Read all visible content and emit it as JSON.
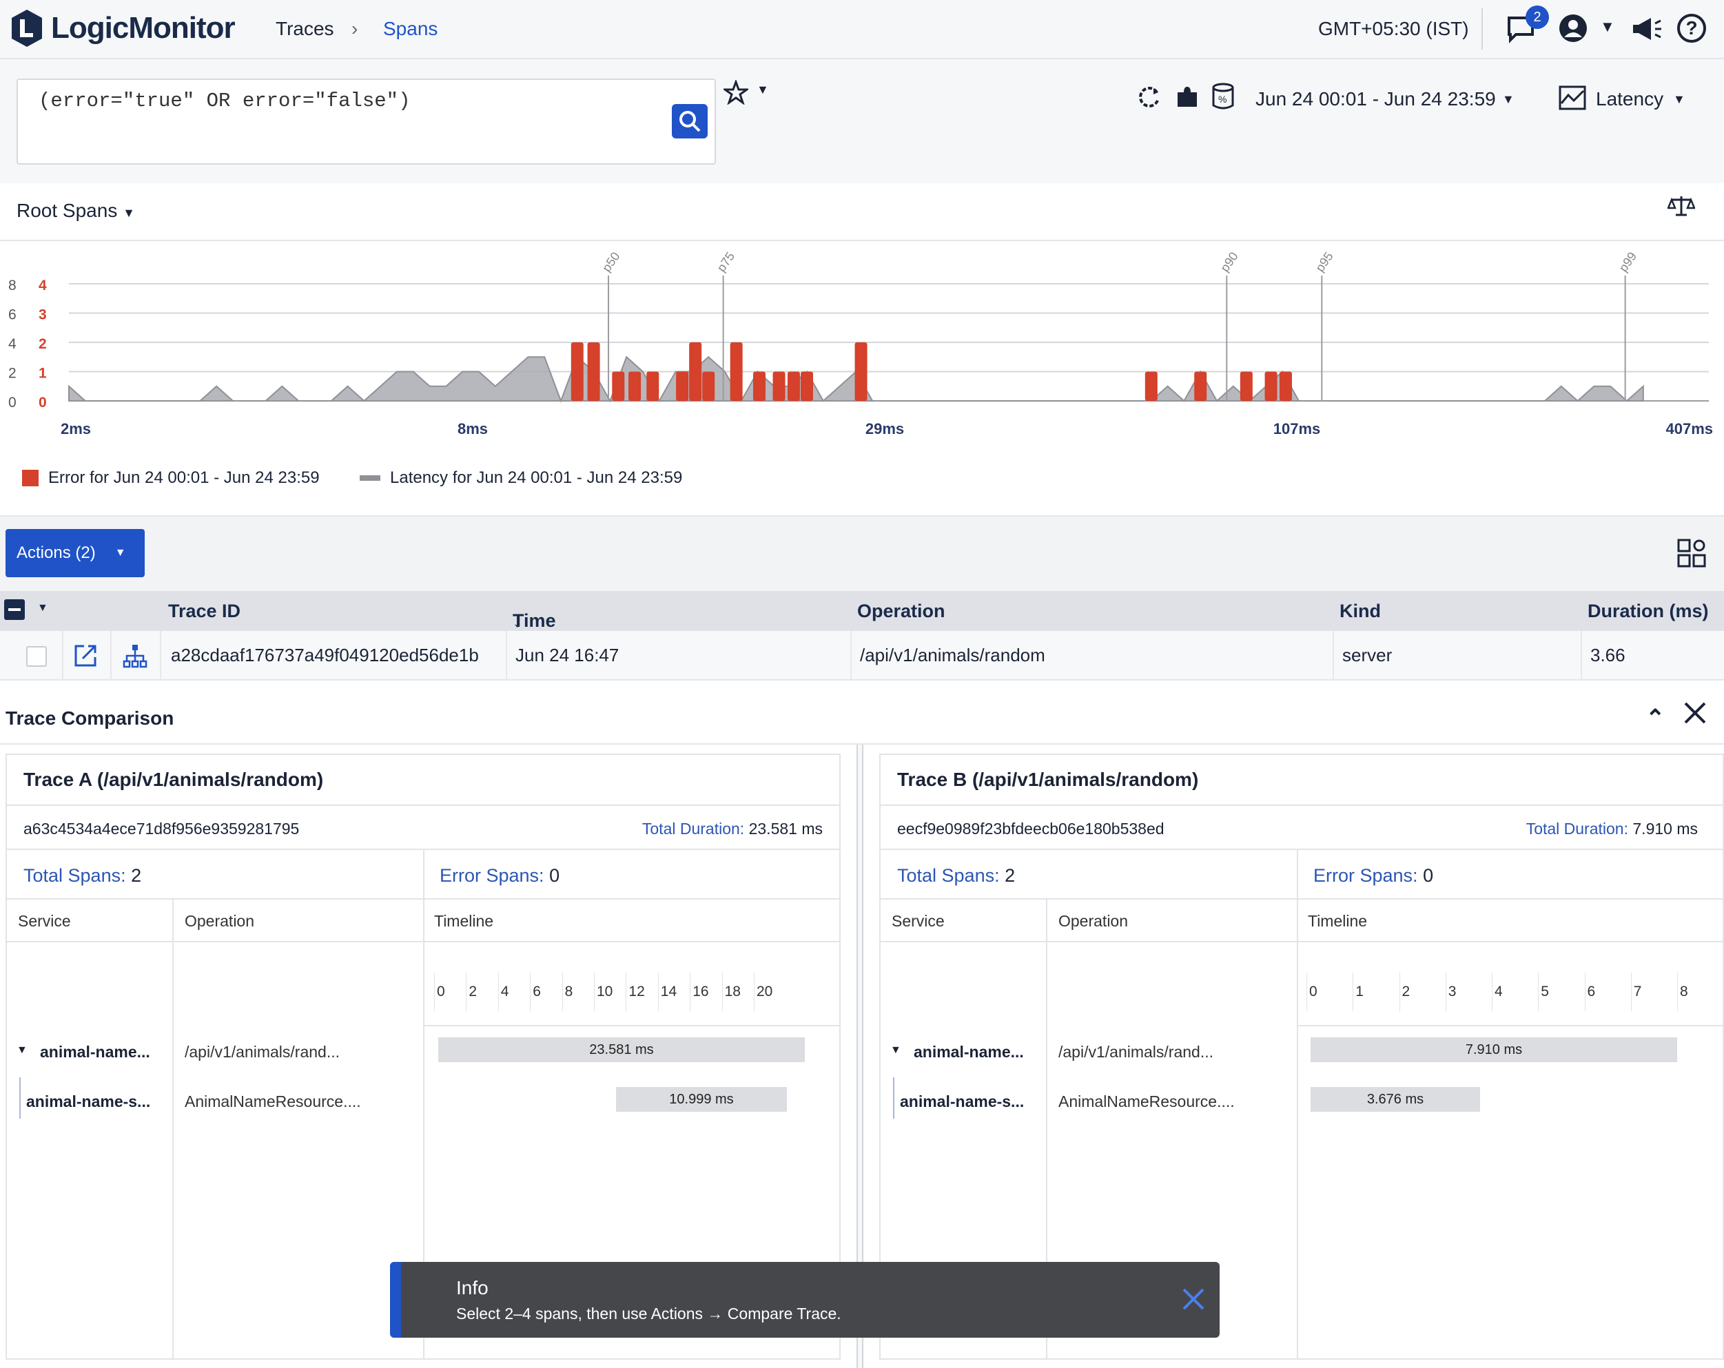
{
  "app": {
    "logo_text": "LogicMonitor"
  },
  "breadcrumb": {
    "parent": "Traces",
    "current": "Spans"
  },
  "header": {
    "timezone": "GMT+05:30 (IST)",
    "notification_count": "2"
  },
  "query": {
    "text": "(error=\"true\" OR error=\"false\")"
  },
  "toolbar": {
    "time_range": "Jun 24 00:01 - Jun 24 23:59",
    "metric": "Latency"
  },
  "chart_section": {
    "title": "Root Spans"
  },
  "chart_data": {
    "type": "bar",
    "left_axis_ticks": [
      "8",
      "6",
      "4",
      "2",
      "0"
    ],
    "right_axis_ticks": [
      "4",
      "3",
      "2",
      "1",
      "0"
    ],
    "x_tick_labels": [
      "2ms",
      "8ms",
      "29ms",
      "107ms",
      "407ms"
    ],
    "percentile_markers": [
      "p50",
      "p75",
      "p90",
      "p95",
      "p99"
    ],
    "percentile_positions": [
      32.9,
      39.9,
      70.6,
      76.4,
      94.9
    ],
    "error_bars_x": [
      31,
      32,
      33.5,
      34.5,
      35.6,
      37.4,
      38.2,
      39,
      40.7,
      42.1,
      43.3,
      44.2,
      45,
      48.3,
      66,
      69,
      71.8,
      73.3,
      74.2
    ],
    "error_bars_count": [
      2,
      2,
      1,
      1,
      1,
      1,
      2,
      1,
      2,
      1,
      1,
      1,
      1,
      2,
      1,
      1,
      1,
      1,
      1
    ],
    "latency_area": [
      [
        0,
        0.5
      ],
      [
        1,
        0
      ],
      [
        8,
        0
      ],
      [
        9,
        0.5
      ],
      [
        10,
        0
      ],
      [
        12,
        0
      ],
      [
        13,
        0.5
      ],
      [
        14,
        0
      ],
      [
        16,
        0
      ],
      [
        17,
        0.5
      ],
      [
        18,
        0
      ],
      [
        19,
        0.5
      ],
      [
        20,
        1
      ],
      [
        21,
        1
      ],
      [
        22,
        0.5
      ],
      [
        23,
        0.5
      ],
      [
        24,
        1
      ],
      [
        25,
        1
      ],
      [
        26,
        0.5
      ],
      [
        27,
        1
      ],
      [
        28,
        1.5
      ],
      [
        29,
        1.5
      ],
      [
        30,
        0
      ],
      [
        31,
        1.5
      ],
      [
        32,
        1
      ],
      [
        33,
        0
      ],
      [
        34,
        1.5
      ],
      [
        35,
        1
      ],
      [
        36,
        0
      ],
      [
        37,
        1
      ],
      [
        38,
        1
      ],
      [
        39,
        1.5
      ],
      [
        40,
        1
      ],
      [
        41,
        0
      ],
      [
        42,
        1
      ],
      [
        43,
        0.5
      ],
      [
        44,
        0.5
      ],
      [
        45,
        1
      ],
      [
        46,
        0
      ],
      [
        47,
        0.5
      ],
      [
        48,
        1
      ],
      [
        49,
        0
      ],
      [
        66,
        0
      ],
      [
        67,
        0.5
      ],
      [
        68,
        0
      ],
      [
        69,
        1
      ],
      [
        70,
        0
      ],
      [
        71,
        0.5
      ],
      [
        72,
        0
      ],
      [
        73,
        0.5
      ],
      [
        74,
        1
      ],
      [
        75,
        0
      ],
      [
        90,
        0
      ],
      [
        91,
        0.5
      ],
      [
        92,
        0
      ],
      [
        93,
        0.5
      ],
      [
        94,
        0.5
      ],
      [
        95,
        0
      ],
      [
        96,
        0.5
      ]
    ],
    "legend": [
      "Error for Jun 24 00:01 - Jun 24 23:59",
      "Latency for Jun 24 00:01 - Jun 24 23:59"
    ],
    "colors": {
      "error": "#d5412a",
      "latency": "#a9abb1"
    }
  },
  "actions": {
    "label": "Actions (2)"
  },
  "table": {
    "columns": [
      "Trace ID",
      "Time",
      "Operation",
      "Kind",
      "Duration (ms)"
    ],
    "rows": [
      {
        "trace_id": "a28cdaaf176737a49f049120ed56de1b",
        "time": "Jun 24 16:47",
        "operation": "/api/v1/animals/random",
        "kind": "server",
        "duration": "3.66"
      }
    ]
  },
  "comparison": {
    "title": "Trace Comparison",
    "col_service": "Service",
    "col_operation": "Operation",
    "col_timeline": "Timeline",
    "total_spans_label": "Total Spans:",
    "error_spans_label": "Error Spans:",
    "total_duration_label": "Total Duration:",
    "trace_a": {
      "title": "Trace A (/api/v1/animals/random)",
      "id": "a63c4534a4ece71d8f956e9359281795",
      "total_duration": "23.581 ms",
      "total_spans": "2",
      "error_spans": "0",
      "ticks": [
        "0",
        "2",
        "4",
        "6",
        "8",
        "10",
        "12",
        "14",
        "16",
        "18",
        "20"
      ],
      "spans": [
        {
          "service": "animal-name...",
          "operation": "/api/v1/animals/rand...",
          "duration": "23.581 ms"
        },
        {
          "service": "animal-name-s...",
          "operation": "AnimalNameResource....",
          "duration": "10.999 ms"
        }
      ]
    },
    "trace_b": {
      "title": "Trace B (/api/v1/animals/random)",
      "id": "eecf9e0989f23bfdeecb06e180b538ed",
      "total_duration": "7.910 ms",
      "total_spans": "2",
      "error_spans": "0",
      "ticks": [
        "0",
        "1",
        "2",
        "3",
        "4",
        "5",
        "6",
        "7",
        "8"
      ],
      "spans": [
        {
          "service": "animal-name...",
          "operation": "/api/v1/animals/rand...",
          "duration": "7.910 ms"
        },
        {
          "service": "animal-name-s...",
          "operation": "AnimalNameResource....",
          "duration": "3.676 ms"
        }
      ]
    }
  },
  "toast": {
    "title": "Info",
    "message": "Select 2–4 spans, then use Actions → Compare Trace."
  }
}
